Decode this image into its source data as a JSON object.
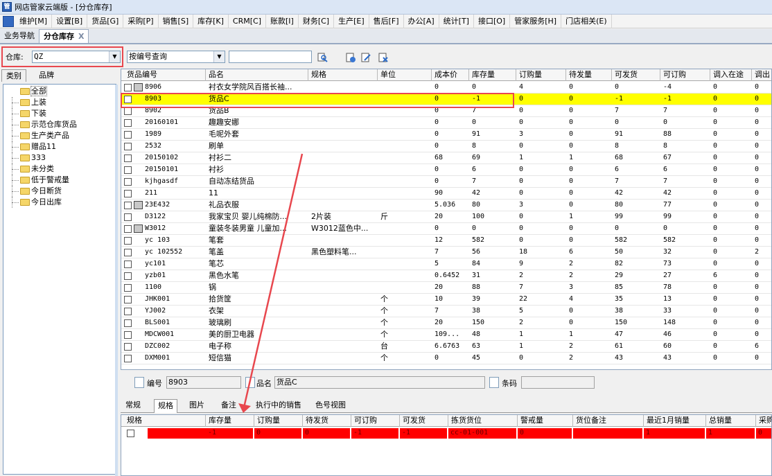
{
  "window": {
    "title": "网店管家云端版 - [分仓库存]"
  },
  "menu": [
    "维护[M]",
    "设置[B]",
    "货品[G]",
    "采购[P]",
    "销售[S]",
    "库存[K]",
    "CRM[C]",
    "账款[I]",
    "财务[C]",
    "生产[E]",
    "售后[F]",
    "办公[A]",
    "统计[T]",
    "接口[O]",
    "管家服务[H]",
    "门店相关(E)"
  ],
  "doc_tabs": [
    {
      "label": "业务导航"
    },
    {
      "label": "分仓库存",
      "close": "X"
    }
  ],
  "toolbar": {
    "warehouse_label": "仓库:",
    "warehouse_value": "QZ",
    "query_mode": "按编号查询",
    "search_value": ""
  },
  "left": {
    "tabs": [
      "类别",
      "品牌"
    ],
    "tree": [
      "全部",
      "上装",
      "下装",
      "示范仓库货品",
      "生产类产品",
      "赠品11",
      "333",
      "未分类",
      "低于警戒量",
      "今日断货",
      "今日出库"
    ]
  },
  "grid": {
    "columns": [
      "货品编号",
      "品名",
      "规格",
      "单位",
      "成本价",
      "库存量",
      "订购量",
      "待发量",
      "可发货",
      "可订购",
      "调入在途",
      "调出"
    ],
    "rows": [
      {
        "pkg": true,
        "code": "8906",
        "name": "衬衣女学院风百搭长袖...",
        "spec": "",
        "unit": "",
        "cost": "0",
        "stock": "0",
        "order": "4",
        "pending": "0",
        "avail": "0",
        "orderable": "-4",
        "in": "0",
        "out": "0"
      },
      {
        "pkg": false,
        "code": "8903",
        "name": "货品C",
        "spec": "",
        "unit": "",
        "cost": "0",
        "stock": "-1",
        "order": "0",
        "pending": "0",
        "avail": "-1",
        "orderable": "-1",
        "in": "0",
        "out": "0",
        "hl": true
      },
      {
        "pkg": false,
        "code": "8902",
        "name": "货品B",
        "spec": "",
        "unit": "",
        "cost": "0",
        "stock": "7",
        "order": "0",
        "pending": "0",
        "avail": "7",
        "orderable": "7",
        "in": "0",
        "out": "0"
      },
      {
        "pkg": false,
        "code": "20160101",
        "name": "趣趣安娜",
        "spec": "",
        "unit": "",
        "cost": "0",
        "stock": "0",
        "order": "0",
        "pending": "0",
        "avail": "0",
        "orderable": "0",
        "in": "0",
        "out": "0"
      },
      {
        "pkg": false,
        "code": "1989",
        "name": "毛呢外套",
        "spec": "",
        "unit": "",
        "cost": "0",
        "stock": "91",
        "order": "3",
        "pending": "0",
        "avail": "91",
        "orderable": "88",
        "in": "0",
        "out": "0"
      },
      {
        "pkg": false,
        "code": "2532",
        "name": "刷单",
        "spec": "",
        "unit": "",
        "cost": "0",
        "stock": "8",
        "order": "0",
        "pending": "0",
        "avail": "8",
        "orderable": "8",
        "in": "0",
        "out": "0"
      },
      {
        "pkg": false,
        "code": "20150102",
        "name": "衬衫二",
        "spec": "",
        "unit": "",
        "cost": "68",
        "stock": "69",
        "order": "1",
        "pending": "1",
        "avail": "68",
        "orderable": "67",
        "in": "0",
        "out": "0"
      },
      {
        "pkg": false,
        "code": "20150101",
        "name": "衬衫",
        "spec": "",
        "unit": "",
        "cost": "0",
        "stock": "6",
        "order": "0",
        "pending": "0",
        "avail": "6",
        "orderable": "6",
        "in": "0",
        "out": "0"
      },
      {
        "pkg": false,
        "code": "kjhgasdf",
        "name": "自动冻结货品",
        "spec": "",
        "unit": "",
        "cost": "0",
        "stock": "7",
        "order": "0",
        "pending": "0",
        "avail": "7",
        "orderable": "7",
        "in": "0",
        "out": "0"
      },
      {
        "pkg": false,
        "code": "211",
        "name": "11",
        "spec": "",
        "unit": "",
        "cost": "90",
        "stock": "42",
        "order": "0",
        "pending": "0",
        "avail": "42",
        "orderable": "42",
        "in": "0",
        "out": "0"
      },
      {
        "pkg": true,
        "code": "23E432",
        "name": "礼品衣服",
        "spec": "",
        "unit": "",
        "cost": "5.036",
        "stock": "80",
        "order": "3",
        "pending": "0",
        "avail": "80",
        "orderable": "77",
        "in": "0",
        "out": "0"
      },
      {
        "pkg": false,
        "code": "D3122",
        "name": "我家宝贝 婴儿纯棉防...",
        "spec": "2片装",
        "unit": "斤",
        "cost": "20",
        "stock": "100",
        "order": "0",
        "pending": "1",
        "avail": "99",
        "orderable": "99",
        "in": "0",
        "out": "0"
      },
      {
        "pkg": true,
        "code": "W3012",
        "name": "童装冬装男童 儿童加...",
        "spec": "W3012蓝色中...",
        "unit": "",
        "cost": "0",
        "stock": "0",
        "order": "0",
        "pending": "0",
        "avail": "0",
        "orderable": "0",
        "in": "0",
        "out": "0"
      },
      {
        "pkg": false,
        "code": "yc 103",
        "name": "笔套",
        "spec": "",
        "unit": "",
        "cost": "12",
        "stock": "582",
        "order": "0",
        "pending": "0",
        "avail": "582",
        "orderable": "582",
        "in": "0",
        "out": "0"
      },
      {
        "pkg": false,
        "code": "yc 102552",
        "name": "笔盖",
        "spec": "黑色塑料笔...",
        "unit": "",
        "cost": "7",
        "stock": "56",
        "order": "18",
        "pending": "6",
        "avail": "50",
        "orderable": "32",
        "in": "0",
        "out": "2"
      },
      {
        "pkg": false,
        "code": "yc101",
        "name": "笔芯",
        "spec": "",
        "unit": "",
        "cost": "5",
        "stock": "84",
        "order": "9",
        "pending": "2",
        "avail": "82",
        "orderable": "73",
        "in": "0",
        "out": "0"
      },
      {
        "pkg": false,
        "code": "yzb01",
        "name": "黑色水笔",
        "spec": "",
        "unit": "",
        "cost": "0.6452",
        "stock": "31",
        "order": "2",
        "pending": "2",
        "avail": "29",
        "orderable": "27",
        "in": "6",
        "out": "0"
      },
      {
        "pkg": false,
        "code": "1100",
        "name": "锅",
        "spec": "",
        "unit": "",
        "cost": "20",
        "stock": "88",
        "order": "7",
        "pending": "3",
        "avail": "85",
        "orderable": "78",
        "in": "0",
        "out": "0"
      },
      {
        "pkg": false,
        "code": "JHK001",
        "name": "拾货筐",
        "spec": "",
        "unit": "个",
        "cost": "10",
        "stock": "39",
        "order": "22",
        "pending": "4",
        "avail": "35",
        "orderable": "13",
        "in": "0",
        "out": "0"
      },
      {
        "pkg": false,
        "code": "YJ002",
        "name": "衣架",
        "spec": "",
        "unit": "个",
        "cost": "7",
        "stock": "38",
        "order": "5",
        "pending": "0",
        "avail": "38",
        "orderable": "33",
        "in": "0",
        "out": "0"
      },
      {
        "pkg": false,
        "code": "BLS001",
        "name": "玻璃刷",
        "spec": "",
        "unit": "个",
        "cost": "20",
        "stock": "150",
        "order": "2",
        "pending": "0",
        "avail": "150",
        "orderable": "148",
        "in": "0",
        "out": "0"
      },
      {
        "pkg": false,
        "code": "MDCW001",
        "name": "美的厨卫电器",
        "spec": "",
        "unit": "个",
        "cost": "109...",
        "stock": "48",
        "order": "1",
        "pending": "1",
        "avail": "47",
        "orderable": "46",
        "in": "0",
        "out": "0"
      },
      {
        "pkg": false,
        "code": "DZC002",
        "name": "电子称",
        "spec": "",
        "unit": "台",
        "cost": "6.6763",
        "stock": "63",
        "order": "1",
        "pending": "2",
        "avail": "61",
        "orderable": "60",
        "in": "0",
        "out": "6"
      },
      {
        "pkg": false,
        "code": "DXM001",
        "name": "短信猫",
        "spec": "",
        "unit": "个",
        "cost": "0",
        "stock": "45",
        "order": "0",
        "pending": "2",
        "avail": "43",
        "orderable": "43",
        "in": "0",
        "out": "0"
      }
    ]
  },
  "detail": {
    "code_label": "编号",
    "code_value": "8903",
    "name_label": "品名",
    "name_value": "货品C",
    "barcode_label": "条码",
    "barcode_value": ""
  },
  "bottom_tabs": [
    "常规",
    "规格",
    "图片",
    "备注",
    "执行中的销售",
    "色号视图"
  ],
  "spec_grid": {
    "columns": [
      "规格",
      "库存量",
      "订购量",
      "待发货",
      "可订购",
      "可发货",
      "拣货货位",
      "警戒量",
      "货位备注",
      "最近1月销量",
      "总销量",
      "采购"
    ],
    "row": [
      "",
      "-1",
      "0",
      "0",
      "-1",
      "-1",
      "cc-01-001",
      "0",
      "",
      "1",
      "1",
      "0"
    ]
  }
}
